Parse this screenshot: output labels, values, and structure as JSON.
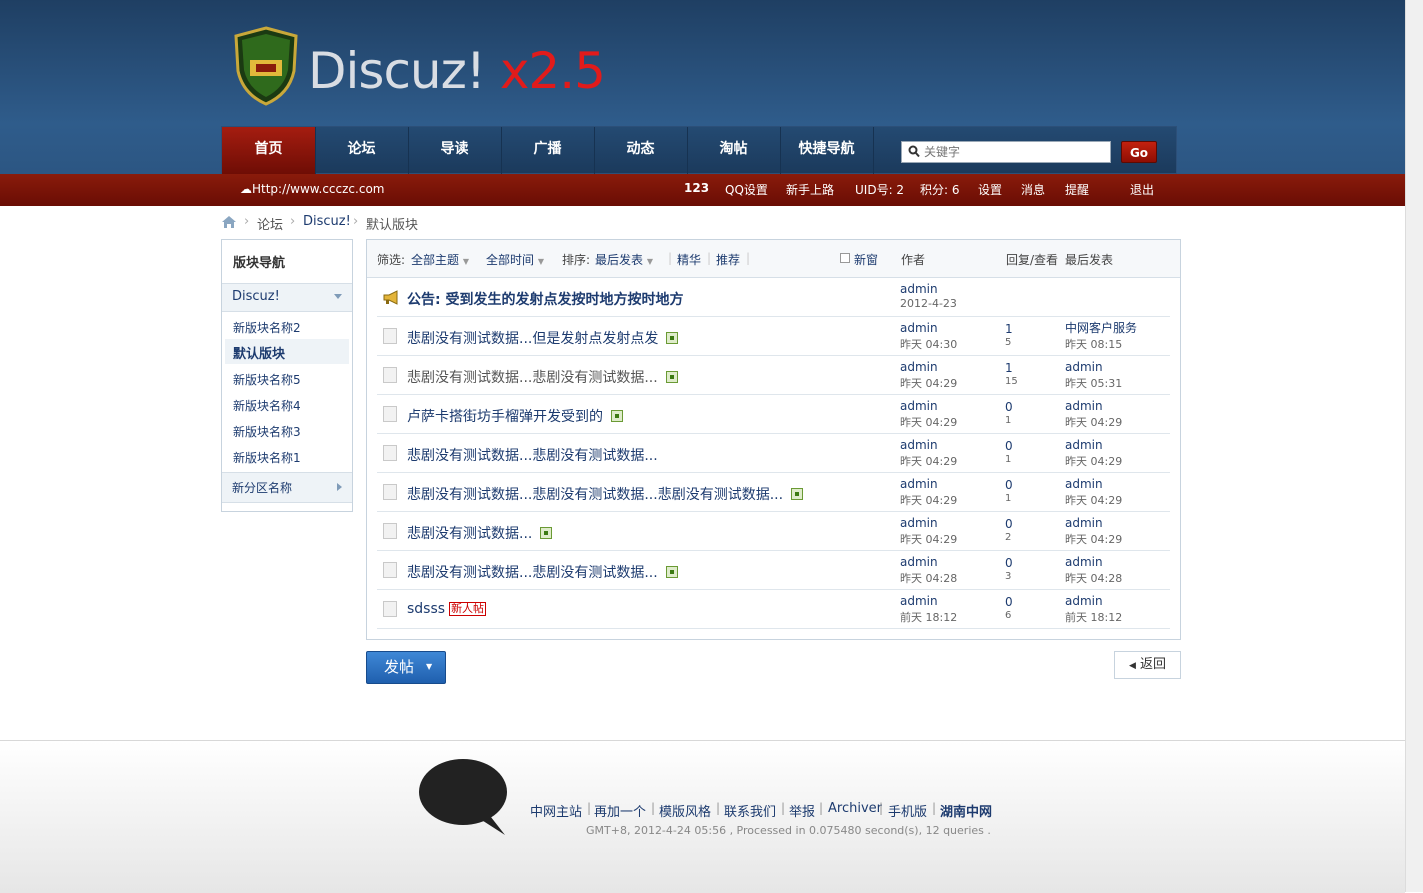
{
  "header": {
    "logo_text_white": "Discuz!",
    "logo_text_red": "x2.5",
    "nav": [
      {
        "label": "首页",
        "active": true
      },
      {
        "label": "论坛"
      },
      {
        "label": "导读"
      },
      {
        "label": "广播"
      },
      {
        "label": "动态"
      },
      {
        "label": "淘帖"
      },
      {
        "label": "快捷导航"
      }
    ],
    "search_placeholder": "关键字",
    "go_label": "Go"
  },
  "topbar": {
    "site_url": "Http://www.ccczc.com",
    "username": "123",
    "qq": "QQ设置",
    "newbie": "新手上路",
    "uid": "UID号: 2",
    "points": "积分: 6",
    "settings": "设置",
    "messages": "消息",
    "reminders": "提醒",
    "logout": "退出"
  },
  "breadcrumb": {
    "items": [
      "论坛",
      "Discuz!",
      "默认版块"
    ],
    "separator": "›"
  },
  "sidebar": {
    "title": "版块导航",
    "group": "Discuz!",
    "items": [
      "新版块名称2",
      "默认版块",
      "新版块名称5",
      "新版块名称4",
      "新版块名称3",
      "新版块名称1"
    ],
    "section": "新分区名称"
  },
  "filter": {
    "filter_label": "筛选:",
    "all_threads": "全部主题",
    "all_time": "全部时间",
    "sort_label": "排序:",
    "sort_value": "最后发表",
    "digest": "精华",
    "recommend": "推荐",
    "new_window": "新窗",
    "col_author": "作者",
    "col_replies": "回复/查看",
    "col_last": "最后发表"
  },
  "announcement": {
    "prefix": "公告:",
    "title": "受到发生的发射点发按时地方按时地方",
    "author": "admin",
    "date": "2012-4-23"
  },
  "threads": [
    {
      "title": "悲剧没有测试数据...但是发射点发射点发",
      "img": true,
      "author": "admin",
      "date": "昨天 04:30",
      "replies": "1",
      "views": "5",
      "last_user": "中网客户服务",
      "last_date": "昨天 08:15"
    },
    {
      "title": "悲剧没有测试数据...悲剧没有测试数据...",
      "img": true,
      "visited": true,
      "author": "admin",
      "date": "昨天 04:29",
      "replies": "1",
      "views": "15",
      "last_user": "admin",
      "last_date": "昨天 05:31"
    },
    {
      "title": "卢萨卡搭街坊手榴弹开发受到的",
      "img": true,
      "author": "admin",
      "date": "昨天 04:29",
      "replies": "0",
      "views": "1",
      "last_user": "admin",
      "last_date": "昨天 04:29"
    },
    {
      "title": "悲剧没有测试数据...悲剧没有测试数据...",
      "img": false,
      "author": "admin",
      "date": "昨天 04:29",
      "replies": "0",
      "views": "1",
      "last_user": "admin",
      "last_date": "昨天 04:29"
    },
    {
      "title": "悲剧没有测试数据...悲剧没有测试数据...悲剧没有测试数据...",
      "img": true,
      "author": "admin",
      "date": "昨天 04:29",
      "replies": "0",
      "views": "1",
      "last_user": "admin",
      "last_date": "昨天 04:29"
    },
    {
      "title": "悲剧没有测试数据...",
      "img": true,
      "author": "admin",
      "date": "昨天 04:29",
      "replies": "0",
      "views": "2",
      "last_user": "admin",
      "last_date": "昨天 04:29"
    },
    {
      "title": "悲剧没有测试数据...悲剧没有测试数据...",
      "img": true,
      "author": "admin",
      "date": "昨天 04:28",
      "replies": "0",
      "views": "3",
      "last_user": "admin",
      "last_date": "昨天 04:28"
    },
    {
      "title": "sdsss",
      "img": false,
      "newbie_badge": "新人帖",
      "author": "admin",
      "date": "前天 18:12",
      "replies": "0",
      "views": "6",
      "last_user": "admin",
      "last_date": "前天 18:12"
    }
  ],
  "actions": {
    "post_label": "发帖",
    "back_label": "返回"
  },
  "footer": {
    "links": [
      "中网主站",
      "再加一个",
      "模版风格",
      "联系我们",
      "举报",
      "Archiver",
      "手机版",
      "湖南中网"
    ],
    "stats": "GMT+8, 2012-4-24 05:56 , Processed in 0.075480 second(s), 12 queries ."
  },
  "colors": {
    "nav_blue": "#1f3f63",
    "topbar_red": "#7a1307",
    "link_blue": "#1d3b6f",
    "post_button": "#2e73c4"
  }
}
